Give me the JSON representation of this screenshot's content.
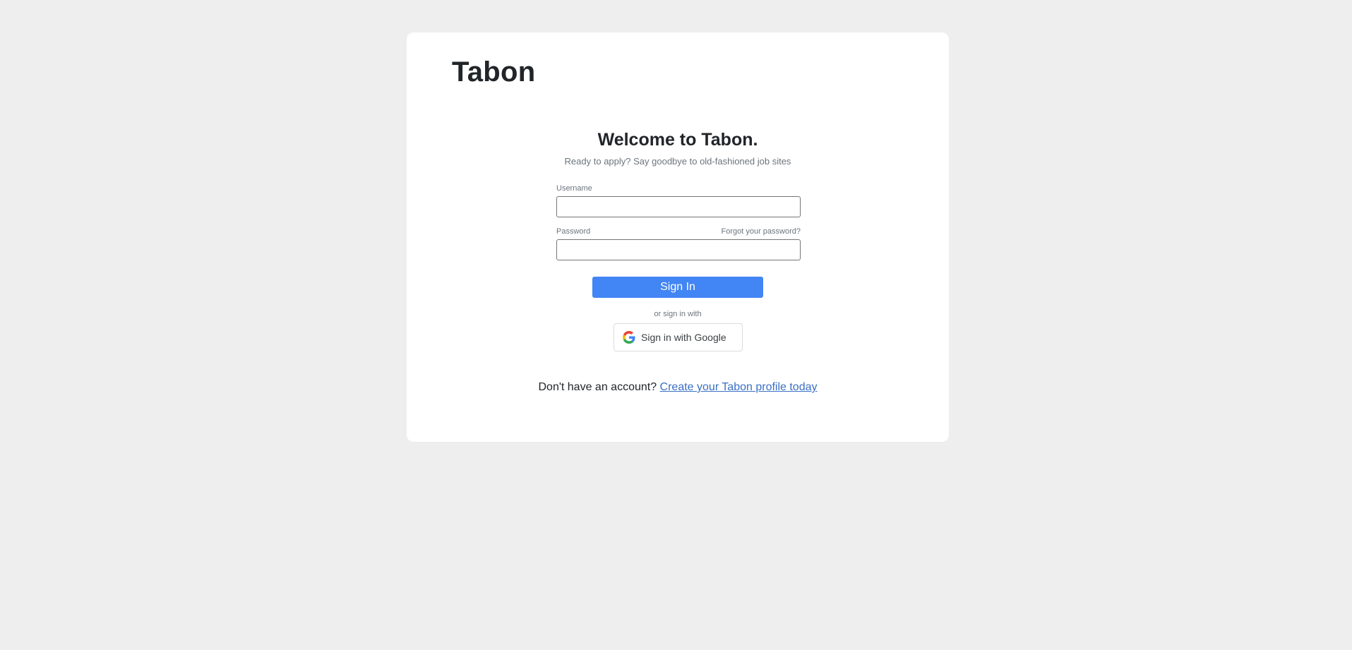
{
  "brand": {
    "name": "Tabon"
  },
  "login": {
    "heading": "Welcome to Tabon.",
    "tagline": "Ready to apply? Say goodbye to old-fashioned job sites",
    "username_label": "Username",
    "username_value": "",
    "password_label": "Password",
    "password_value": "",
    "forgot_password": "Forgot your password?",
    "submit_label": "Sign In",
    "alt_divider": "or sign in with",
    "google_label": "Sign in with Google",
    "google_icon": "google-g-icon",
    "signup_prompt": "Don't have an account?",
    "signup_link": "Create your Tabon profile today"
  },
  "colors": {
    "background": "#eeeeee",
    "card": "#ffffff",
    "primary": "#4285f4",
    "link": "#3a6fc4",
    "muted": "#6c757d"
  }
}
